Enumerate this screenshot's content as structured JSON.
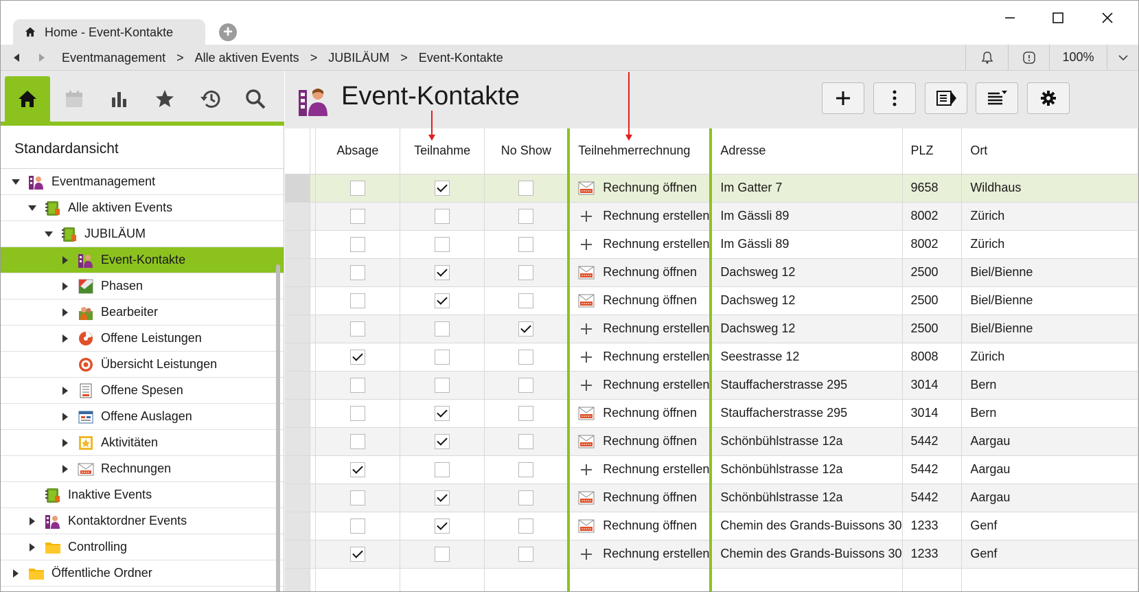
{
  "window": {
    "tab_title": "Home - Event-Kontakte",
    "new_tab_icon": "plus-circle-icon"
  },
  "nav": {
    "breadcrumb": [
      "Eventmanagement",
      "Alle aktiven Events",
      "JUBILÄUM",
      "Event-Kontakte"
    ],
    "separator": ">",
    "zoom": "100%"
  },
  "sidebar": {
    "icons": [
      "home-icon",
      "calendar-icon",
      "chart-icon",
      "star-icon",
      "history-icon",
      "search-icon"
    ],
    "view_title": "Standardansicht",
    "tree": [
      {
        "label": "Eventmanagement",
        "level": 0,
        "expander": "down",
        "icon": "contacts-folder-icon"
      },
      {
        "label": "Alle aktiven Events",
        "level": 1,
        "expander": "down",
        "icon": "events-folder-icon"
      },
      {
        "label": "JUBILÄUM",
        "level": 2,
        "expander": "down",
        "icon": "event-icon"
      },
      {
        "label": "Event-Kontakte",
        "level": 3,
        "expander": "right",
        "icon": "contacts-icon",
        "selected": true
      },
      {
        "label": "Phasen",
        "level": 3,
        "expander": "right",
        "icon": "phases-icon"
      },
      {
        "label": "Bearbeiter",
        "level": 3,
        "expander": "right",
        "icon": "staff-icon"
      },
      {
        "label": "Offene Leistungen",
        "level": 3,
        "expander": "right",
        "icon": "pie-icon"
      },
      {
        "label": "Übersicht Leistungen",
        "level": 3,
        "expander": "none",
        "icon": "target-icon"
      },
      {
        "label": "Offene Spesen",
        "level": 3,
        "expander": "right",
        "icon": "receipt-icon"
      },
      {
        "label": "Offene Auslagen",
        "level": 3,
        "expander": "right",
        "icon": "expenses-icon"
      },
      {
        "label": "Aktivitäten",
        "level": 3,
        "expander": "right",
        "icon": "activity-icon"
      },
      {
        "label": "Rechnungen",
        "level": 3,
        "expander": "right",
        "icon": "invoice-icon"
      },
      {
        "label": "Inaktive Events",
        "level": 1,
        "expander": "none",
        "icon": "events-folder-icon"
      },
      {
        "label": "Kontaktordner Events",
        "level": 1,
        "expander": "right",
        "icon": "contacts-folder-icon"
      },
      {
        "label": "Controlling",
        "level": 1,
        "expander": "right",
        "icon": "folder-icon"
      },
      {
        "label": "Öffentliche Ordner",
        "level": 0,
        "expander": "right",
        "icon": "folder-icon"
      }
    ]
  },
  "main": {
    "title": "Event-Kontakte",
    "toolbar": [
      "add-icon",
      "more-icon",
      "view-icon",
      "sort-icon",
      "settings-icon"
    ],
    "columns": {
      "absage": "Absage",
      "teilnahme": "Teilnahme",
      "noshow": "No Show",
      "rechnung": "Teilnehmerrechnung",
      "adresse": "Adresse",
      "plz": "PLZ",
      "ort": "Ort"
    },
    "rows": [
      {
        "absage": false,
        "teilnahme": true,
        "noshow": false,
        "inv": "open",
        "rechnung": "Rechnung öffnen",
        "adresse": "Im Gatter 7",
        "plz": "9658",
        "ort": "Wildhaus"
      },
      {
        "absage": false,
        "teilnahme": false,
        "noshow": false,
        "inv": "create",
        "rechnung": "Rechnung erstellen",
        "adresse": "Im Gässli 89",
        "plz": "8002",
        "ort": "Zürich"
      },
      {
        "absage": false,
        "teilnahme": false,
        "noshow": false,
        "inv": "create",
        "rechnung": "Rechnung erstellen",
        "adresse": "Im Gässli 89",
        "plz": "8002",
        "ort": "Zürich"
      },
      {
        "absage": false,
        "teilnahme": true,
        "noshow": false,
        "inv": "open",
        "rechnung": "Rechnung öffnen",
        "adresse": "Dachsweg 12",
        "plz": "2500",
        "ort": "Biel/Bienne"
      },
      {
        "absage": false,
        "teilnahme": true,
        "noshow": false,
        "inv": "open",
        "rechnung": "Rechnung öffnen",
        "adresse": "Dachsweg 12",
        "plz": "2500",
        "ort": "Biel/Bienne"
      },
      {
        "absage": false,
        "teilnahme": false,
        "noshow": true,
        "inv": "create",
        "rechnung": "Rechnung erstellen",
        "adresse": "Dachsweg 12",
        "plz": "2500",
        "ort": "Biel/Bienne"
      },
      {
        "absage": true,
        "teilnahme": false,
        "noshow": false,
        "inv": "create",
        "rechnung": "Rechnung erstellen",
        "adresse": "Seestrasse 12",
        "plz": "8008",
        "ort": "Zürich"
      },
      {
        "absage": false,
        "teilnahme": false,
        "noshow": false,
        "inv": "create",
        "rechnung": "Rechnung erstellen",
        "adresse": "Stauffacherstrasse 295",
        "plz": "3014",
        "ort": "Bern"
      },
      {
        "absage": false,
        "teilnahme": true,
        "noshow": false,
        "inv": "open",
        "rechnung": "Rechnung öffnen",
        "adresse": "Stauffacherstrasse 295",
        "plz": "3014",
        "ort": "Bern"
      },
      {
        "absage": false,
        "teilnahme": true,
        "noshow": false,
        "inv": "open",
        "rechnung": "Rechnung öffnen",
        "adresse": "Schönbühlstrasse 12a",
        "plz": "5442",
        "ort": "Aargau"
      },
      {
        "absage": true,
        "teilnahme": false,
        "noshow": false,
        "inv": "create",
        "rechnung": "Rechnung erstellen",
        "adresse": "Schönbühlstrasse 12a",
        "plz": "5442",
        "ort": "Aargau"
      },
      {
        "absage": false,
        "teilnahme": true,
        "noshow": false,
        "inv": "open",
        "rechnung": "Rechnung öffnen",
        "adresse": "Schönbühlstrasse 12a",
        "plz": "5442",
        "ort": "Aargau"
      },
      {
        "absage": false,
        "teilnahme": true,
        "noshow": false,
        "inv": "open",
        "rechnung": "Rechnung öffnen",
        "adresse": "Chemin des Grands-Buissons 30",
        "plz": "1233",
        "ort": "Genf"
      },
      {
        "absage": true,
        "teilnahme": false,
        "noshow": false,
        "inv": "create",
        "rechnung": "Rechnung erstellen",
        "adresse": "Chemin des Grands-Buissons 30",
        "plz": "1233",
        "ort": "Genf"
      }
    ]
  },
  "colors": {
    "accent": "#8cc21e",
    "highlight_row": "#e8f0d8",
    "annotation": "#e02020"
  }
}
